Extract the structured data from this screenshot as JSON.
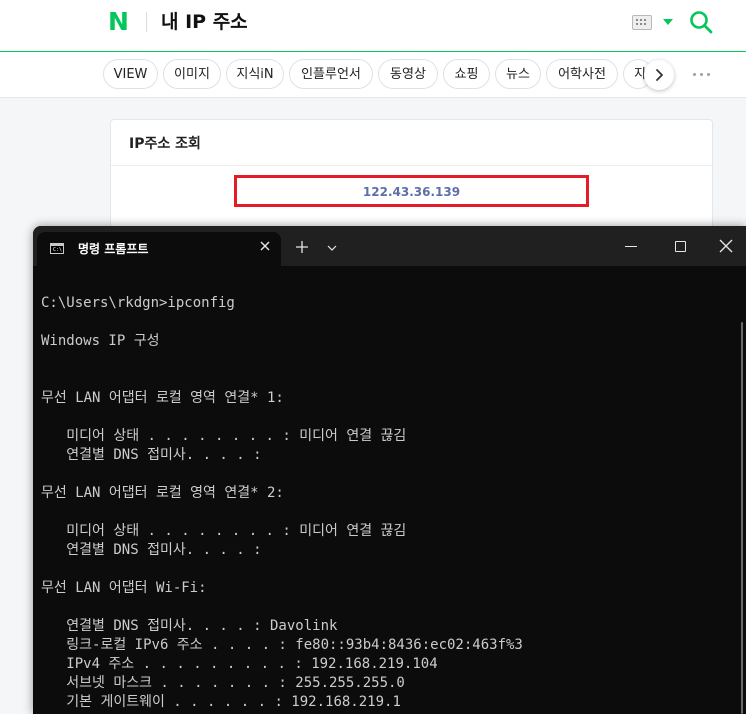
{
  "header": {
    "logo": "N",
    "query": "내 IP 주소",
    "icons": [
      "keyboard-icon",
      "dropdown-triangle-icon",
      "search-icon"
    ],
    "brand_color": "#03c75a"
  },
  "tabs": [
    {
      "label": "VIEW"
    },
    {
      "label": "이미지"
    },
    {
      "label": "지식iN"
    },
    {
      "label": "인플루언서"
    },
    {
      "label": "동영상"
    },
    {
      "label": "쇼핑"
    },
    {
      "label": "뉴스"
    },
    {
      "label": "어학사전"
    },
    {
      "label": "지"
    }
  ],
  "ip_card": {
    "title": "IP주소 조회",
    "ip": "122.43.36.139",
    "highlight_color": "#e51b2a"
  },
  "terminal": {
    "tab_title": "명령 프롬프트",
    "lines": [
      "C:\\Users\\rkdgn>ipconfig",
      "Windows IP 구성",
      "무선 LAN 어댑터 로컬 영역 연결* 1:",
      "   미디어 상태 . . . . . . . . : 미디어 연결 끊김",
      "   연결별 DNS 접미사. . . . :",
      "무선 LAN 어댑터 로컬 영역 연결* 2:",
      "   미디어 상태 . . . . . . . . : 미디어 연결 끊김",
      "   연결별 DNS 접미사. . . . :",
      "무선 LAN 어댑터 Wi-Fi:",
      "   연결별 DNS 접미사. . . . : Davolink",
      "   링크-로컬 IPv6 주소 . . . . : fe80::93b4:8436:ec02:463f%3",
      "   IPv4 주소 . . . . . . . . . : 192.168.219.104",
      "   서브넷 마스크 . . . . . . . : 255.255.255.0",
      "   기본 게이트웨이 . . . . . . : 192.168.219.1"
    ]
  }
}
